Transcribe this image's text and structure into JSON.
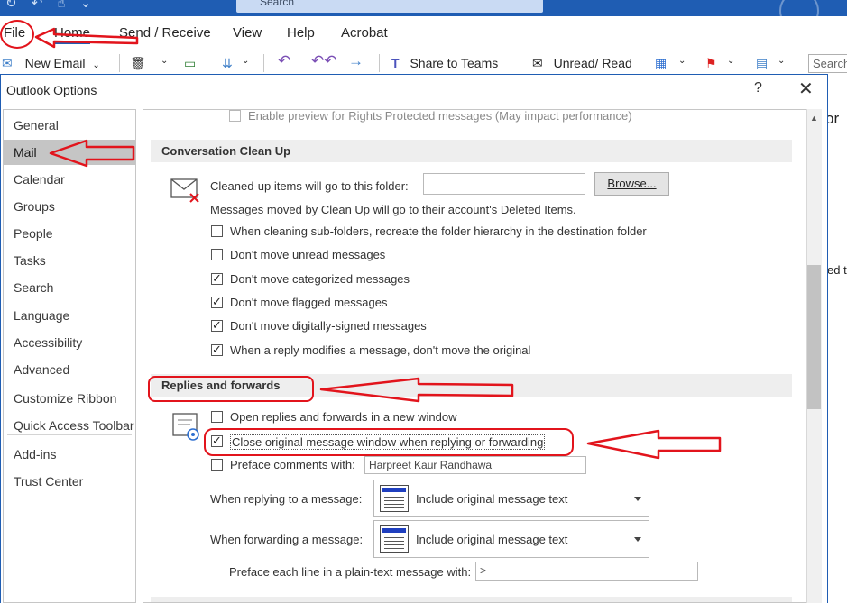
{
  "titlebar": {
    "search_placeholder": "Search",
    "qa_icons": [
      "refresh-icon",
      "undo-icon",
      "touch-mode-icon",
      "customize-chevron-icon"
    ]
  },
  "menu": {
    "file": "File",
    "home": "Home",
    "send_receive": "Send / Receive",
    "view": "View",
    "help": "Help",
    "acrobat": "Acrobat"
  },
  "ribbon": {
    "new_email": "New Email",
    "share_to_teams": "Share to Teams",
    "unread_read": "Unread/ Read",
    "search_partial": "Search"
  },
  "dialog": {
    "title": "Outlook Options",
    "help_glyph": "?",
    "close_glyph": "✕"
  },
  "nav": {
    "items": [
      {
        "label": "General",
        "active": false
      },
      {
        "label": "Mail",
        "active": true
      },
      {
        "label": "Calendar",
        "active": false
      },
      {
        "label": "Groups",
        "active": false
      },
      {
        "label": "People",
        "active": false
      },
      {
        "label": "Tasks",
        "active": false
      },
      {
        "label": "Search",
        "active": false
      },
      {
        "label": "Language",
        "active": false
      },
      {
        "label": "Accessibility",
        "active": false
      },
      {
        "label": "Advanced",
        "active": false
      },
      {
        "label": "Customize Ribbon",
        "active": false
      },
      {
        "label": "Quick Access Toolbar",
        "active": false
      },
      {
        "label": "Add-ins",
        "active": false
      },
      {
        "label": "Trust Center",
        "active": false
      }
    ]
  },
  "content": {
    "rights_protected": {
      "label": "Enable preview for Rights Protected messages (May impact performance)",
      "checked": false
    },
    "cleanup": {
      "header": "Conversation Clean Up",
      "folder_label": "Cleaned-up items will go to this folder:",
      "folder_value": "",
      "browse_button": "Browse...",
      "note": "Messages moved by Clean Up will go to their account's Deleted Items.",
      "options": [
        {
          "label": "When cleaning sub-folders, recreate the folder hierarchy in the destination folder",
          "checked": false
        },
        {
          "label": "Don't move unread messages",
          "checked": false
        },
        {
          "label": "Don't move categorized messages",
          "checked": true
        },
        {
          "label": "Don't move flagged messages",
          "checked": true
        },
        {
          "label": "Don't move digitally-signed messages",
          "checked": true
        },
        {
          "label": "When a reply modifies a message, don't move the original",
          "checked": true
        }
      ]
    },
    "replies": {
      "header": "Replies and forwards",
      "open_new_window": {
        "label": "Open replies and forwards in a new window",
        "checked": false
      },
      "close_original": {
        "label": "Close original message window when replying or forwarding",
        "checked": true
      },
      "preface_comments": {
        "label": "Preface comments with:",
        "checked": false,
        "value": "Harpreet Kaur Randhawa"
      },
      "when_replying_label": "When replying to a message:",
      "when_replying_value": "Include original message text",
      "when_forwarding_label": "When forwarding a message:",
      "when_forwarding_value": "Include original message text",
      "preface_plain_label": "Preface each line in a plain-text message with:",
      "preface_plain_value": ">"
    }
  },
  "background": {
    "text_or": "or",
    "text_edt": "ed t"
  },
  "colors": {
    "titlebar": "#1f5db3",
    "annotation_red": "#e2141c",
    "nav_active": "#c5c5c5",
    "section_bar": "#eeeeee"
  }
}
